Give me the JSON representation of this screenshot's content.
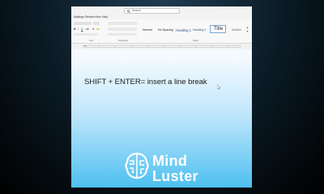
{
  "titlebar": {
    "search_placeholder": "Search"
  },
  "menubar": {
    "items": [
      "Mailings",
      "Review",
      "View",
      "Help"
    ]
  },
  "ribbon": {
    "styles": {
      "normal": "Normal",
      "no_spacing": "No Spacing",
      "heading1": "Heading 1",
      "heading2": "Heading 2",
      "title": "Title",
      "subtitle": "Subtitle"
    },
    "groups": [
      "Font",
      "Paragraph",
      "Styles"
    ]
  },
  "document": {
    "text": "SHIFT + ENTER= insert a line break"
  },
  "watermark": {
    "line1": "Mind",
    "line2": "Luster"
  },
  "colors": {
    "heading_blue": "#2f5496",
    "bottom_gradient": "#4ec0f0",
    "brand": "#ffffff"
  }
}
